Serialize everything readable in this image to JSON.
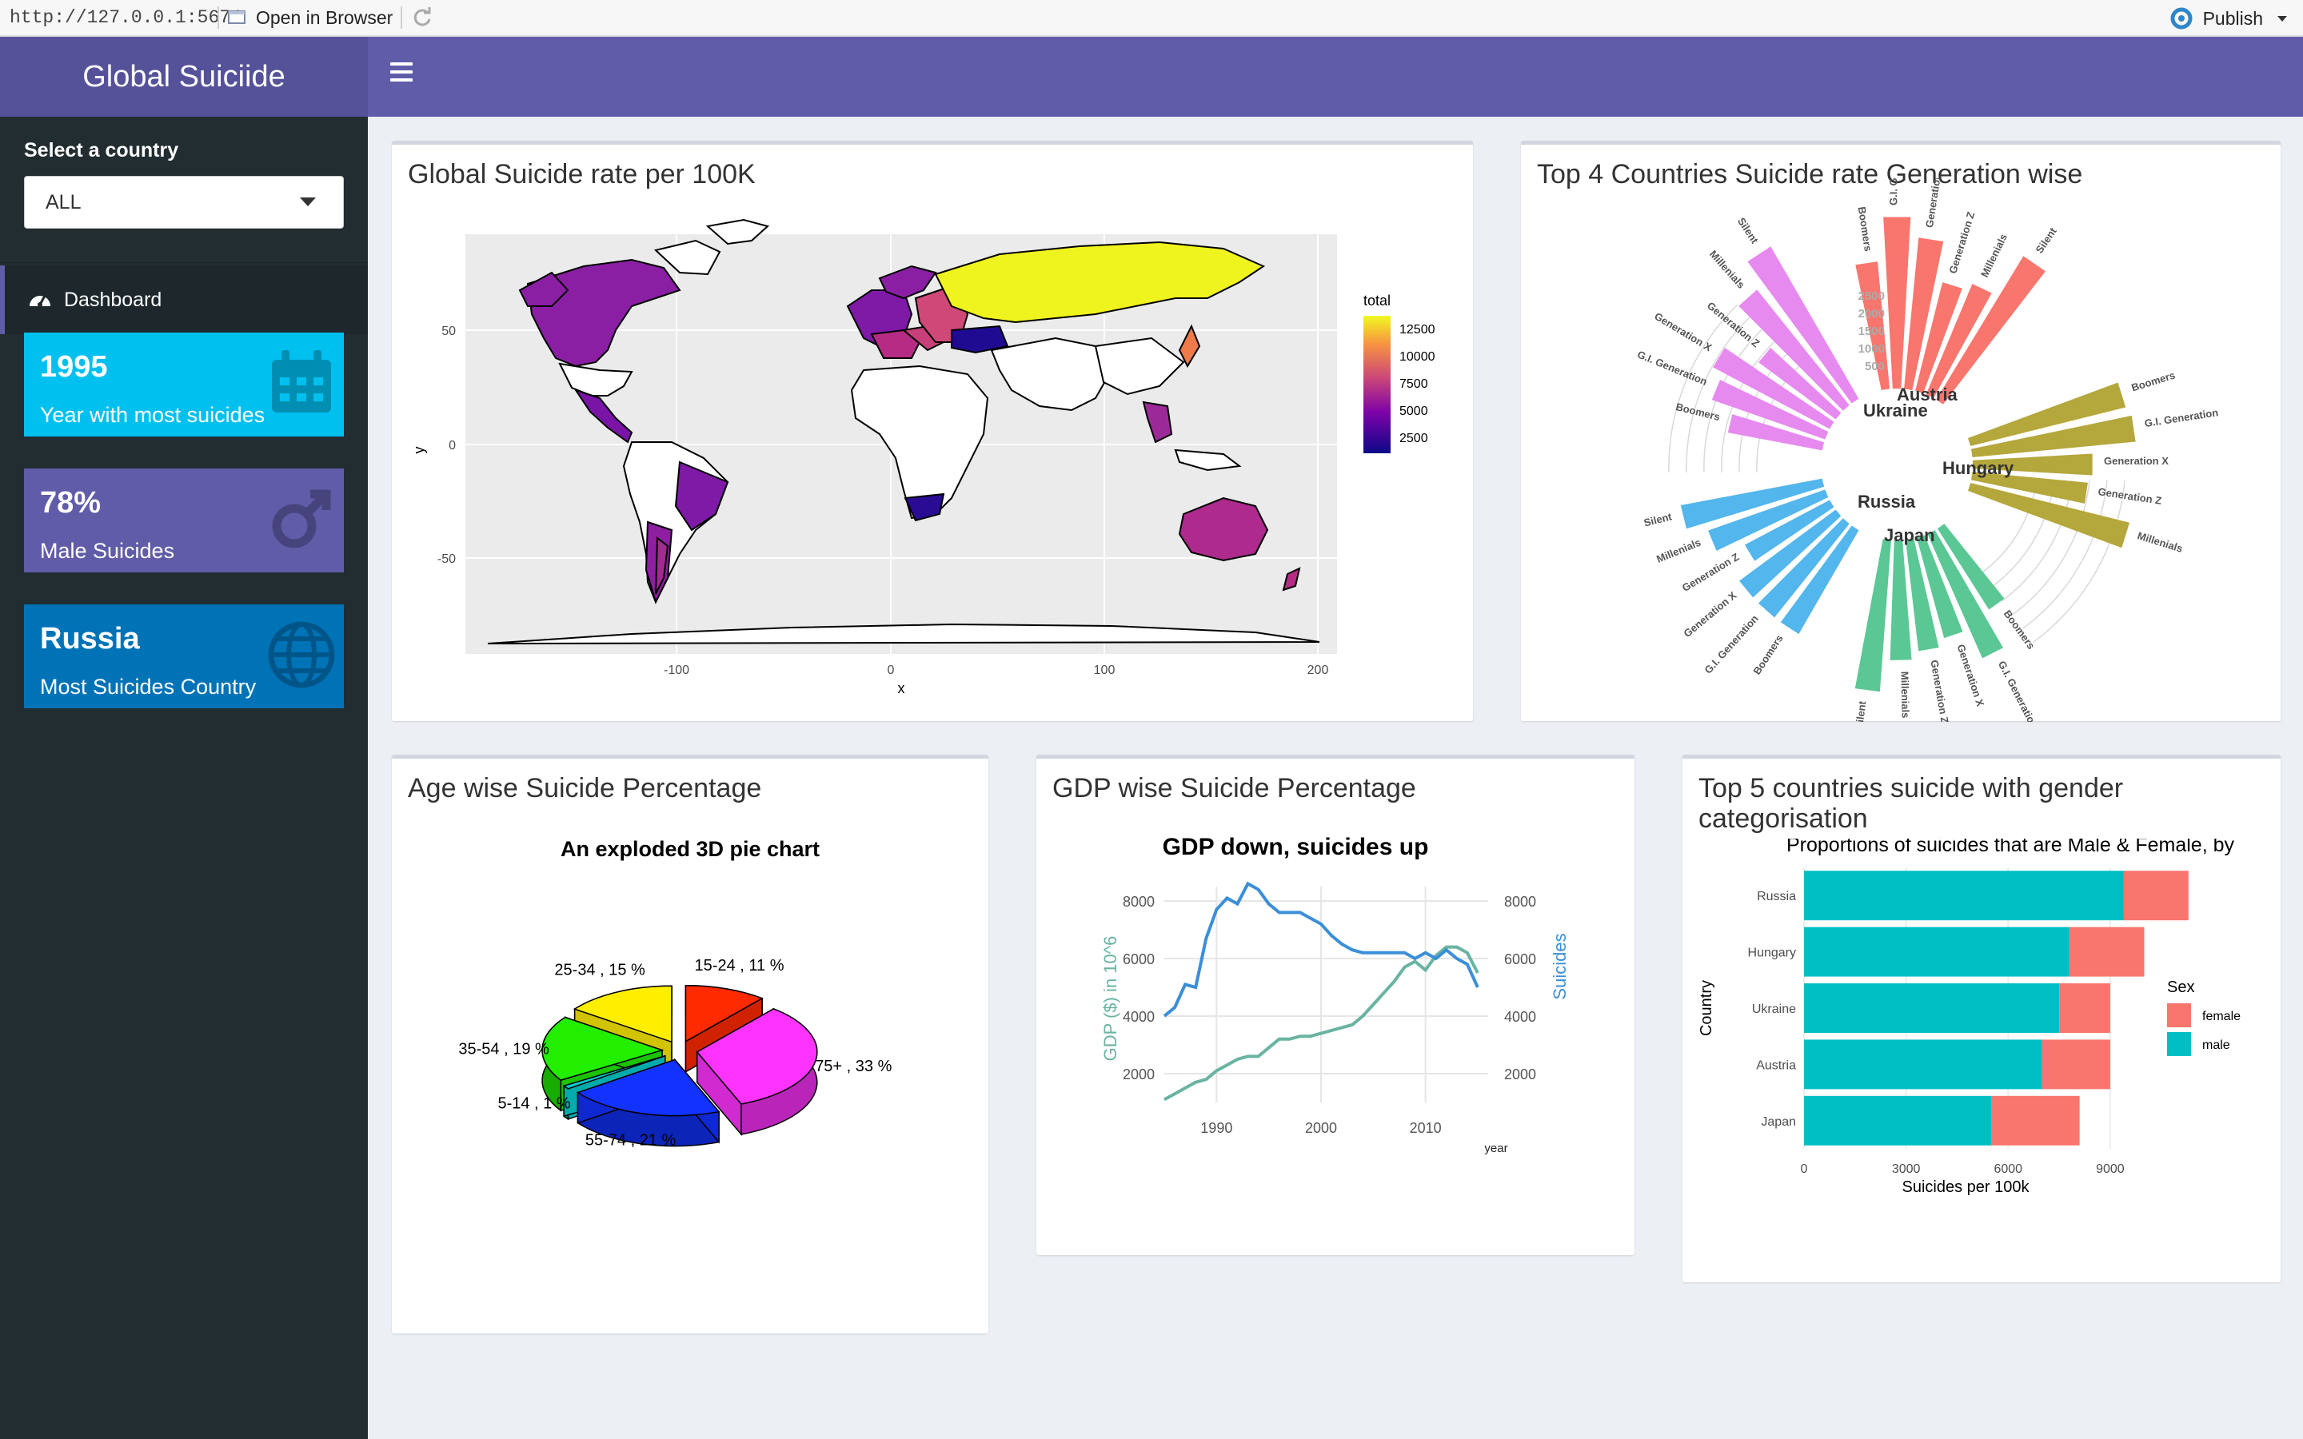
{
  "browser": {
    "url": "http://127.0.0.1:5674",
    "open_label": "Open in Browser",
    "publish_label": "Publish"
  },
  "app": {
    "title": "Global Suiciide"
  },
  "sidebar": {
    "select_label": "Select a country",
    "select_value": "ALL",
    "menu": [
      {
        "label": "Dashboard",
        "icon": "dashboard-icon"
      }
    ]
  },
  "value_boxes": [
    {
      "value": "1995",
      "subtitle": "Year with most suicides",
      "icon": "calendar-icon",
      "color": "#00c0ef"
    },
    {
      "value": "78%",
      "subtitle": "Male Suicides",
      "icon": "male-icon",
      "color": "#605ca8"
    },
    {
      "value": "Russia",
      "subtitle": "Most Suicides Country",
      "icon": "globe-icon",
      "color": "#0073b7"
    }
  ],
  "cards": {
    "map": "Global Suicide rate per 100K",
    "polar": "Top 4 Countries Suicide rate Generation wise",
    "pie": "Age wise Suicide Percentage",
    "gdp": "GDP wise Suicide Percentage",
    "gender": "Top 5 countries suicide with gender categorisation"
  },
  "chart_data": [
    {
      "type": "heatmap",
      "ylabel": "y",
      "xlabel": "x",
      "x_ticks": [
        "-100",
        "0",
        "100",
        "200"
      ],
      "y_ticks": [
        "50",
        "0",
        "-50"
      ],
      "legend_title": "total",
      "legend_ticks": [
        "12500",
        "10000",
        "7500",
        "5000",
        "2500"
      ],
      "palette": [
        "#0d0887",
        "#7e03a8",
        "#cc4778",
        "#f89540",
        "#f0f921"
      ]
    },
    {
      "type": "bar",
      "polar": true,
      "radial_ticks": [
        "2500",
        "2000",
        "1500",
        "1000",
        "500"
      ],
      "groups": [
        "Austria",
        "Hungary",
        "Japan",
        "Russia",
        "Ukraine"
      ],
      "group_colors": {
        "Austria": "#f8766d",
        "Hungary": "#b4a73c",
        "Japan": "#5bc794",
        "Russia": "#53b6ec",
        "Ukraine": "#e78af0"
      },
      "categories": [
        "Boomers",
        "G.I. Gen",
        "Generation X",
        "Generation Z",
        "Millenials",
        "Silent",
        "G.I. Generation"
      ]
    },
    {
      "type": "pie",
      "title": "An exploded 3D pie chart",
      "slices": [
        {
          "label": "15-24 , 11 %",
          "value": 11,
          "color": "#ff2a00"
        },
        {
          "label": "75+ , 33 %",
          "value": 33,
          "color": "#ff33ff"
        },
        {
          "label": "55-74 , 21 %",
          "value": 21,
          "color": "#1132ff"
        },
        {
          "label": "5-14 , 1 %",
          "value": 1,
          "color": "#00d0d0"
        },
        {
          "label": "35-54 , 19 %",
          "value": 19,
          "color": "#22ee00"
        },
        {
          "label": "25-34 , 15 %",
          "value": 15,
          "color": "#ffee00"
        }
      ]
    },
    {
      "type": "line",
      "title": "GDP down, suicides up",
      "ylabel": "GDP ($) in 10^6",
      "y2label": "Suicides",
      "xlabel": "year",
      "x_ticks": [
        "1990",
        "2000",
        "2010"
      ],
      "y_ticks": [
        "8000",
        "6000",
        "4000",
        "2000"
      ],
      "y2_ticks": [
        "8000",
        "6000",
        "4000",
        "2000"
      ],
      "xlim": [
        1985,
        2016
      ],
      "ylim": [
        1000,
        8500
      ],
      "series": [
        {
          "name": "GDP ($) in 10^6",
          "color": "#69b3a2",
          "x": [
            1985,
            1986,
            1987,
            1988,
            1989,
            1990,
            1991,
            1992,
            1993,
            1994,
            1995,
            1996,
            1997,
            1998,
            1999,
            2000,
            2001,
            2002,
            2003,
            2004,
            2005,
            2006,
            2007,
            2008,
            2009,
            2010,
            2011,
            2012,
            2013,
            2014,
            2015
          ],
          "values": [
            1100,
            1300,
            1500,
            1700,
            1800,
            2100,
            2300,
            2500,
            2600,
            2600,
            2900,
            3200,
            3200,
            3300,
            3300,
            3400,
            3500,
            3600,
            3700,
            4000,
            4400,
            4800,
            5200,
            5700,
            5900,
            5600,
            6100,
            6400,
            6400,
            6200,
            5500
          ]
        },
        {
          "name": "Suicides",
          "color": "#3b8fd8",
          "x": [
            1985,
            1986,
            1987,
            1988,
            1989,
            1990,
            1991,
            1992,
            1993,
            1994,
            1995,
            1996,
            1997,
            1998,
            1999,
            2000,
            2001,
            2002,
            2003,
            2004,
            2005,
            2006,
            2007,
            2008,
            2009,
            2010,
            2011,
            2012,
            2013,
            2014,
            2015
          ],
          "values": [
            4000,
            4300,
            5100,
            5000,
            6700,
            7700,
            8100,
            7900,
            8600,
            8400,
            7900,
            7600,
            7600,
            7600,
            7400,
            7200,
            6800,
            6500,
            6300,
            6200,
            6200,
            6200,
            6200,
            6200,
            6000,
            6200,
            6000,
            6300,
            6000,
            5800,
            5000
          ]
        }
      ]
    },
    {
      "type": "bar",
      "title": "Proportions of suicides that are Male & Female, by",
      "xlabel": "Suicides per 100k",
      "ylabel": "Country",
      "legend_title": "Sex",
      "categories": [
        "Russia",
        "Hungary",
        "Ukraine",
        "Austria",
        "Japan"
      ],
      "x_ticks": [
        "0",
        "3000",
        "6000",
        "9000"
      ],
      "xlim": [
        0,
        11000
      ],
      "series": [
        {
          "name": "male",
          "color": "#00bfc4",
          "values": [
            9400,
            7800,
            7500,
            7000,
            5500
          ]
        },
        {
          "name": "female",
          "color": "#f8766d",
          "values": [
            1900,
            2200,
            1500,
            2000,
            2600
          ]
        }
      ]
    }
  ]
}
